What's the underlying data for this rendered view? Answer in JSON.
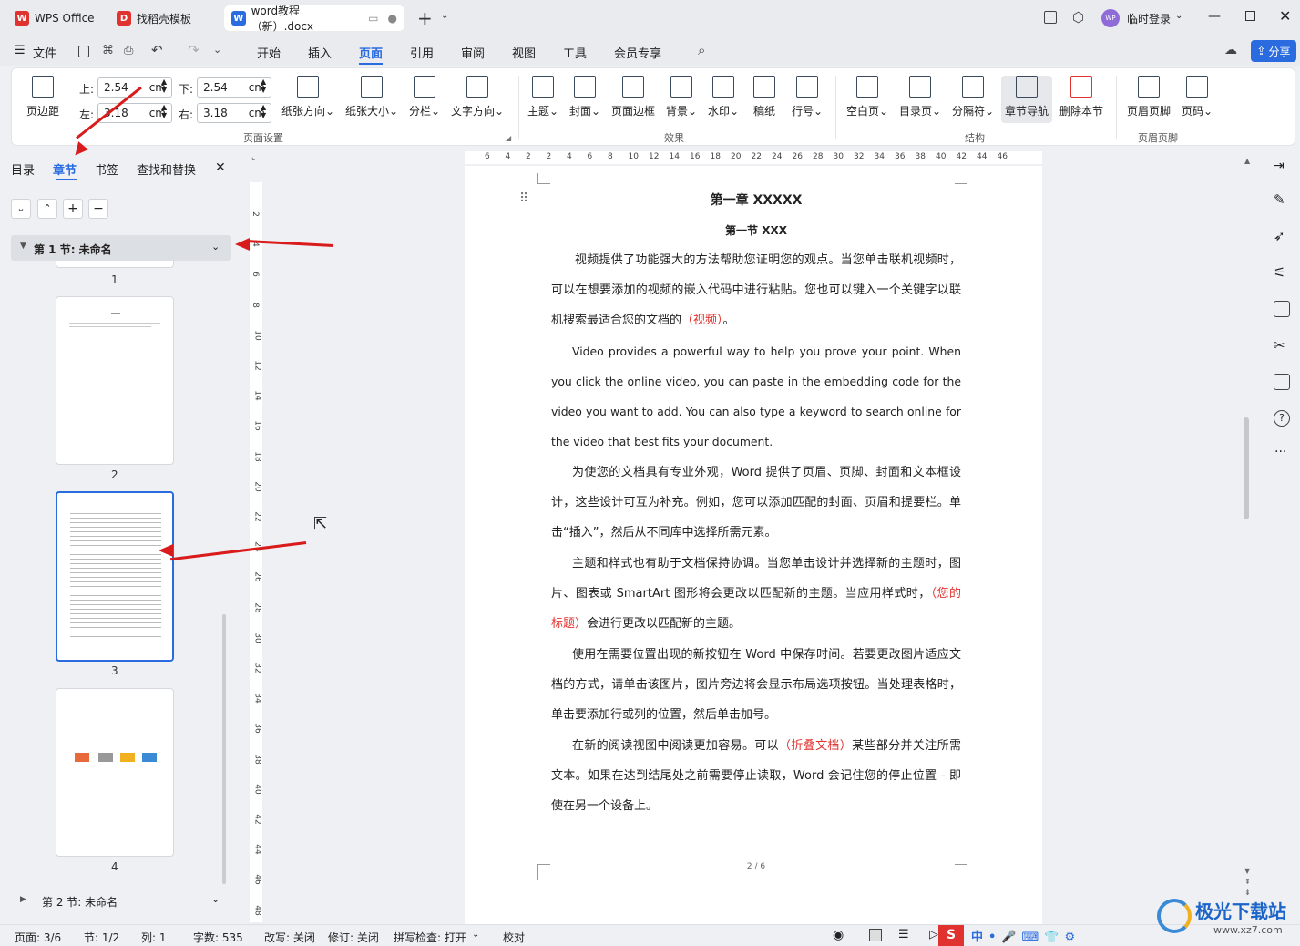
{
  "tabs": [
    {
      "label": "WPS Office"
    },
    {
      "label": "找稻壳模板"
    },
    {
      "label": "word教程（新）.docx"
    }
  ],
  "title_right": {
    "login": "临时登录",
    "avatar": "WP"
  },
  "menu": {
    "file": "文件",
    "items": [
      "开始",
      "插入",
      "页面",
      "引用",
      "审阅",
      "视图",
      "工具",
      "会员专享"
    ],
    "active": "页面",
    "share": "分享"
  },
  "ribbon": {
    "margin": {
      "label": "页边距",
      "top_label": "上:",
      "top": "2.54",
      "bottom_label": "下:",
      "bottom": "2.54",
      "left_label": "左:",
      "left": "3.18",
      "right_label": "右:",
      "right": "3.18",
      "unit": "cm"
    },
    "page_setup": [
      "纸张方向",
      "纸张大小",
      "分栏",
      "文字方向"
    ],
    "effects": [
      "主题",
      "封面",
      "页面边框",
      "背景",
      "水印",
      "稿纸",
      "行号"
    ],
    "structure": [
      "空白页",
      "目录页",
      "分隔符",
      "章节导航",
      "删除本节"
    ],
    "hf": [
      "页眉页脚",
      "页码"
    ],
    "groups": {
      "setup": "页面设置",
      "effects": "效果",
      "structure": "结构",
      "hf": "页眉页脚"
    }
  },
  "panel": {
    "tabs": [
      "目录",
      "章节",
      "书签",
      "查找和替换"
    ],
    "active": "章节",
    "section1": "第 1 节: 未命名",
    "section2": "第 2 节: 未命名",
    "page_numbers": [
      "1",
      "2",
      "3",
      "4"
    ]
  },
  "ruler_h": [
    "6",
    "4",
    "2",
    "2",
    "4",
    "6",
    "8",
    "10",
    "12",
    "14",
    "16",
    "18",
    "20",
    "22",
    "24",
    "26",
    "28",
    "30",
    "32",
    "34",
    "36",
    "38",
    "40",
    "42",
    "44",
    "46"
  ],
  "ruler_v": [
    "2",
    "4",
    "6",
    "8",
    "10",
    "12",
    "14",
    "16",
    "18",
    "20",
    "22",
    "24",
    "26",
    "28",
    "30",
    "32",
    "34",
    "36",
    "38",
    "40",
    "42",
    "44",
    "46",
    "48"
  ],
  "doc": {
    "chapter": "第一章  XXXXX",
    "section": "第一节  XXX",
    "p1a": "视频提供了功能强大的方法帮助您证明您的观点。当您单击联机视频时，可以在想要添加的视频的嵌入代码中进行粘贴。您也可以键入一个关键字以联机搜索最适合您的文档的",
    "p1b": "（视频）",
    "p1c": "。",
    "p2": "Video provides a powerful way to help you prove your point. When you click the online video, you can paste in the embedding code for the video you want to add. You can also type a keyword to search online for the video that best fits your document.",
    "p3": "为使您的文档具有专业外观，Word 提供了页眉、页脚、封面和文本框设计，这些设计可互为补充。例如，您可以添加匹配的封面、页眉和提要栏。单击“插入”，然后从不同库中选择所需元素。",
    "p4a": "主题和样式也有助于文档保持协调。当您单击设计并选择新的主题时，图片、图表或 SmartArt 图形将会更改以匹配新的主题。当应用样式时，",
    "p4b": "（您的标题）",
    "p4c": "会进行更改以匹配新的主题。",
    "p5": "使用在需要位置出现的新按钮在 Word 中保存时间。若要更改图片适应文档的方式，请单击该图片，图片旁边将会显示布局选项按钮。当处理表格时，单击要添加行或列的位置，然后单击加号。",
    "p6a": "在新的阅读视图中阅读更加容易。可以",
    "p6b": "（折叠文档）",
    "p6c": "某些部分并关注所需文本。如果在达到结尾处之前需要停止读取，Word 会记住您的停止位置 - 即使在另一个设备上。",
    "page_footer": "2 / 6"
  },
  "status": {
    "page": "页面: 3/6",
    "section": "节: 1/2",
    "col": "列: 1",
    "words": "字数: 535",
    "rev": "改写: 关闭",
    "track": "修订: 关闭",
    "spell": "拼写检查: 打开",
    "proof": "校对"
  },
  "watermark": {
    "text": "极光下载站",
    "url": "www.xz7.com"
  },
  "colors": {
    "accent": "#2a6be0",
    "red": "#e0322e"
  }
}
